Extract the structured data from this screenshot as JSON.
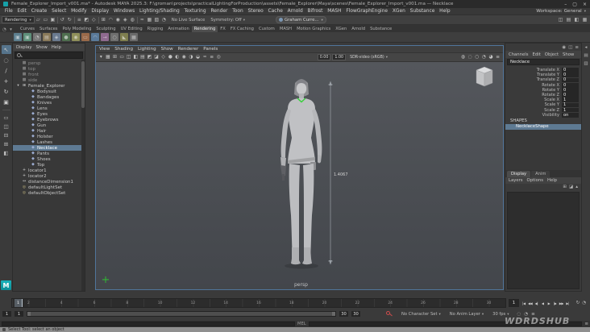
{
  "window": {
    "title": "Female_Explorer_Import_v001.ma* - Autodesk MAYA 2025.3: F:\\groman\\projects\\practicalLightingForProduction\\assets\\Female_Explorer\\Maya\\scenes\\Female_Explorer_Import_v001.ma — Necklace",
    "controls": {
      "minimize": "–",
      "maximize": "▢",
      "close": "×"
    }
  },
  "menu_bar": {
    "items": [
      "File",
      "Edit",
      "Create",
      "Select",
      "Modify",
      "Display",
      "Windows",
      "Lighting/Shading",
      "Texturing",
      "Render",
      "Toon",
      "Stereo",
      "Cache",
      "Arnold",
      "Bifrost",
      "MASH",
      "FlowGraphEngine",
      "XGen",
      "Substance",
      "Help"
    ],
    "workspace_label": "Workspace:",
    "workspace_value": "General"
  },
  "status_line": {
    "menuset_label": "Rendering",
    "icons": [
      {
        "name": "new-scene-icon",
        "g": "▱"
      },
      {
        "name": "open-scene-icon",
        "g": "▭"
      },
      {
        "name": "save-scene-icon",
        "g": "▣"
      },
      {
        "name": "separator",
        "g": "",
        "cls": "sep"
      },
      {
        "name": "undo-icon",
        "g": "↺"
      },
      {
        "name": "redo-icon",
        "g": "↻"
      },
      {
        "name": "separator",
        "g": "",
        "cls": "sep"
      },
      {
        "name": "select-hierarchy-icon",
        "g": "≡"
      },
      {
        "name": "select-object-icon",
        "g": "◩"
      },
      {
        "name": "select-component-icon",
        "g": "◇"
      },
      {
        "name": "separator",
        "g": "",
        "cls": "sep"
      },
      {
        "name": "snap-grid-icon",
        "g": "⊞"
      },
      {
        "name": "snap-curve-icon",
        "g": "◠"
      },
      {
        "name": "snap-point-icon",
        "g": "◉"
      },
      {
        "name": "snap-plane-icon",
        "g": "◈"
      },
      {
        "name": "make-live-icon",
        "g": "◍"
      },
      {
        "name": "separator",
        "g": "",
        "cls": "sep"
      },
      {
        "name": "construction-history-icon",
        "g": "≈"
      },
      {
        "name": "render-frame-icon",
        "g": "▦"
      },
      {
        "name": "ipr-render-icon",
        "g": "▧"
      },
      {
        "name": "render-settings-icon",
        "g": "◔"
      }
    ],
    "no_live_surface": "No Live Surface",
    "symmetry_label": "Symmetry: Off",
    "account_label": "Graham Curre...",
    "right_icons": [
      {
        "name": "modeling-toolkit-toggle-icon",
        "g": "◫"
      },
      {
        "name": "attribute-editor-toggle-icon",
        "g": "▤"
      },
      {
        "name": "tool-settings-toggle-icon",
        "g": "◧"
      },
      {
        "name": "channel-box-toggle-icon",
        "g": "▦"
      }
    ]
  },
  "shelf": {
    "tabs": [
      {
        "label": "Curves",
        "cls": ""
      },
      {
        "label": "Surfaces",
        "cls": ""
      },
      {
        "label": "Poly Modeling",
        "cls": ""
      },
      {
        "label": "Sculpting",
        "cls": ""
      },
      {
        "label": "UV Editing",
        "cls": ""
      },
      {
        "label": "Rigging",
        "cls": ""
      },
      {
        "label": "Animation",
        "cls": ""
      },
      {
        "label": "Rendering",
        "cls": "active"
      },
      {
        "label": "FX",
        "cls": ""
      },
      {
        "label": "FX Caching",
        "cls": ""
      },
      {
        "label": "Custom",
        "cls": ""
      },
      {
        "label": "MASH",
        "cls": ""
      },
      {
        "label": "Motion Graphics",
        "cls": ""
      },
      {
        "label": "XGen",
        "cls": ""
      },
      {
        "label": "Arnold",
        "cls": ""
      },
      {
        "label": "Substance",
        "cls": ""
      }
    ],
    "icons": [
      {
        "name": "render-current-frame-icon",
        "c": "#5d7f8f",
        "g": "▣"
      },
      {
        "name": "ipr-render-shelf-icon",
        "c": "#5d8f7a",
        "g": "▣"
      },
      {
        "name": "render-settings-shelf-icon",
        "c": "#757575",
        "g": "◔"
      },
      {
        "name": "render-view-icon",
        "c": "#8a7a5a",
        "g": "▤"
      },
      {
        "name": "hypershade-icon",
        "c": "#6a7a8f",
        "g": "◈"
      },
      {
        "name": "standard-surface-icon",
        "c": "#4f6f4f",
        "g": "●"
      },
      {
        "name": "arnold-light-icon",
        "c": "#8f8f5a",
        "g": "◉"
      },
      {
        "name": "area-light-icon",
        "c": "#9a6a4a",
        "g": "▭"
      },
      {
        "name": "skydome-light-icon",
        "c": "#5a7a9a",
        "g": "◠"
      },
      {
        "name": "directional-light-icon",
        "c": "#8f6a8f",
        "g": "→"
      },
      {
        "name": "point-light-icon",
        "c": "#6f6f6f",
        "g": "○"
      },
      {
        "name": "spot-light-icon",
        "c": "#7f7f4f",
        "g": "◣"
      },
      {
        "name": "camera-shelf-icon",
        "c": "#6a6a6a",
        "g": "▦"
      }
    ]
  },
  "toolbox": {
    "tools": [
      {
        "name": "select-tool",
        "g": "↖",
        "cls": "active"
      },
      {
        "name": "lasso-select-tool",
        "g": "◌",
        "cls": ""
      },
      {
        "name": "paint-select-tool",
        "g": "∕",
        "cls": ""
      },
      {
        "name": "move-tool",
        "g": "+",
        "cls": ""
      },
      {
        "name": "rotate-tool",
        "g": "↻",
        "cls": ""
      },
      {
        "name": "scale-tool",
        "g": "▣",
        "cls": ""
      }
    ],
    "layouts": [
      {
        "name": "single-pane-layout",
        "g": "▭"
      },
      {
        "name": "two-pane-side-layout",
        "g": "◫"
      },
      {
        "name": "two-pane-stacked-layout",
        "g": "⊟"
      },
      {
        "name": "four-pane-layout",
        "g": "⊞"
      },
      {
        "name": "outliner-persp-layout",
        "g": "◧"
      }
    ],
    "logo_label": "M"
  },
  "outliner": {
    "menus": [
      "Display",
      "Show",
      "Help"
    ],
    "items": [
      {
        "label": "persp",
        "cls": "cam",
        "icon": "▦",
        "exp": ""
      },
      {
        "label": "top",
        "cls": "cam",
        "icon": "▦",
        "exp": ""
      },
      {
        "label": "front",
        "cls": "cam",
        "icon": "▦",
        "exp": ""
      },
      {
        "label": "side",
        "cls": "cam",
        "icon": "▦",
        "exp": ""
      },
      {
        "label": "Female_Explorer",
        "cls": "xform",
        "icon": "⊞",
        "exp": "▾"
      },
      {
        "label": "Bodysuit",
        "cls": "d1 mesh",
        "icon": "◆",
        "exp": ""
      },
      {
        "label": "Bandages",
        "cls": "d1 mesh",
        "icon": "◆",
        "exp": ""
      },
      {
        "label": "Knives",
        "cls": "d1 mesh",
        "icon": "◆",
        "exp": ""
      },
      {
        "label": "Lens",
        "cls": "d1 mesh",
        "icon": "◆",
        "exp": ""
      },
      {
        "label": "Eyes",
        "cls": "d1 mesh",
        "icon": "◆",
        "exp": ""
      },
      {
        "label": "Eyebrows",
        "cls": "d1 mesh",
        "icon": "◆",
        "exp": ""
      },
      {
        "label": "Gun",
        "cls": "d1 mesh",
        "icon": "◆",
        "exp": ""
      },
      {
        "label": "Hair",
        "cls": "d1 mesh",
        "icon": "◆",
        "exp": ""
      },
      {
        "label": "Holster",
        "cls": "d1 mesh",
        "icon": "◆",
        "exp": ""
      },
      {
        "label": "Lashes",
        "cls": "d1 mesh",
        "icon": "◆",
        "exp": ""
      },
      {
        "label": "Necklace",
        "cls": "d1 mesh selected",
        "icon": "◆",
        "exp": ""
      },
      {
        "label": "Pants",
        "cls": "d1 mesh",
        "icon": "◆",
        "exp": ""
      },
      {
        "label": "Shoes",
        "cls": "d1 mesh",
        "icon": "◆",
        "exp": ""
      },
      {
        "label": "Top",
        "cls": "d1 mesh",
        "icon": "◆",
        "exp": ""
      },
      {
        "label": "locator1",
        "cls": "loc",
        "icon": "+",
        "exp": ""
      },
      {
        "label": "locator2",
        "cls": "loc",
        "icon": "+",
        "exp": ""
      },
      {
        "label": "distanceDimension1",
        "cls": "dim",
        "icon": "↔",
        "exp": ""
      },
      {
        "label": "defaultLightSet",
        "cls": "set",
        "icon": "◎",
        "exp": ""
      },
      {
        "label": "defaultObjectSet",
        "cls": "set",
        "icon": "◎",
        "exp": ""
      }
    ]
  },
  "viewport": {
    "menus": [
      "View",
      "Shading",
      "Lighting",
      "Show",
      "Renderer",
      "Panels"
    ],
    "toolbar_left": [
      {
        "name": "camera-menu-icon",
        "g": "▾"
      },
      {
        "name": "camera-select-icon",
        "g": "▦"
      },
      {
        "name": "grid-toggle-icon",
        "g": "⊞"
      },
      {
        "name": "film-gate-icon",
        "g": "▭"
      },
      {
        "name": "resolution-gate-icon",
        "g": "◫"
      },
      {
        "name": "gate-mask-icon",
        "g": "◧"
      },
      {
        "name": "field-chart-icon",
        "g": "▤"
      },
      {
        "name": "safe-action-icon",
        "g": "◩"
      },
      {
        "name": "safe-title-icon",
        "g": "◪"
      },
      {
        "name": "wireframe-icon",
        "g": "◇"
      },
      {
        "name": "shaded-icon",
        "g": "●"
      },
      {
        "name": "textured-icon",
        "g": "◐"
      },
      {
        "name": "use-all-lights-icon",
        "g": "◉"
      },
      {
        "name": "shadows-icon",
        "g": "◑"
      },
      {
        "name": "ambient-occlusion-icon",
        "g": "◒"
      },
      {
        "name": "motion-blur-icon",
        "g": "≈"
      },
      {
        "name": "anti-aliasing-icon",
        "g": "≡"
      },
      {
        "name": "depth-of-field-icon",
        "g": "◎"
      }
    ],
    "exposure": "0.00",
    "gamma": "1.00",
    "view_transform": "SDR-video (sRGB)",
    "toolbar_right": [
      {
        "name": "isolate-select-icon",
        "g": "◍"
      },
      {
        "name": "xray-icon",
        "g": "◌"
      },
      {
        "name": "joints-xray-icon",
        "g": "○"
      },
      {
        "name": "exposure-icon",
        "g": "◔"
      },
      {
        "name": "gamma-icon",
        "g": "◕"
      },
      {
        "name": "viewport-options-icon",
        "g": "≡"
      }
    ],
    "camera_label": "persp",
    "measurement": "1.4067"
  },
  "channel_box": {
    "top_icons": [
      {
        "name": "pin-panel-icon",
        "g": "◉"
      },
      {
        "name": "panel-layout-icon",
        "g": "◫"
      },
      {
        "name": "panel-menu-icon",
        "g": "≡"
      }
    ],
    "menus": [
      "Channels",
      "Edit",
      "Object",
      "Show"
    ],
    "object_name": "Necklace",
    "attributes": [
      {
        "name": "Translate X",
        "value": "0"
      },
      {
        "name": "Translate Y",
        "value": "0"
      },
      {
        "name": "Translate Z",
        "value": "0"
      },
      {
        "name": "Rotate X",
        "value": "0"
      },
      {
        "name": "Rotate Y",
        "value": "0"
      },
      {
        "name": "Rotate Z",
        "value": "0"
      },
      {
        "name": "Scale X",
        "value": "1"
      },
      {
        "name": "Scale Y",
        "value": "1"
      },
      {
        "name": "Scale Z",
        "value": "1"
      },
      {
        "name": "Visibility",
        "value": "on"
      }
    ],
    "shapes_label": "SHAPES",
    "shape_name": "NecklaceShape"
  },
  "layer_editor": {
    "tabs": [
      {
        "label": "Display",
        "cls": "active"
      },
      {
        "label": "Anim",
        "cls": ""
      }
    ],
    "menus": [
      "Layers",
      "Options",
      "Help"
    ],
    "icons": [
      {
        "name": "new-empty-layer-icon",
        "g": "⊞"
      },
      {
        "name": "new-layer-from-selected-icon",
        "g": "◪"
      },
      {
        "name": "move-layer-up-icon",
        "g": "▴"
      }
    ]
  },
  "right_strip": {
    "icons": [
      {
        "name": "collapse-sidebar-icon",
        "g": "◂"
      },
      {
        "name": "channel-box-tab-icon",
        "g": "▤"
      },
      {
        "name": "layer-editor-tab-icon",
        "g": "▥"
      }
    ]
  },
  "timeline": {
    "labels": [
      "2",
      "4",
      "6",
      "8",
      "10",
      "12",
      "14",
      "16",
      "18",
      "20",
      "22",
      "24",
      "26",
      "28",
      "30"
    ],
    "current_frame": "1",
    "current_time_field": "1",
    "transport": [
      {
        "name": "go-to-start-button",
        "g": "|◀"
      },
      {
        "name": "step-back-key-button",
        "g": "◀◀"
      },
      {
        "name": "step-back-frame-button",
        "g": "◀|"
      },
      {
        "name": "play-backward-button",
        "g": "◀"
      },
      {
        "name": "play-forward-button",
        "g": "▶"
      },
      {
        "name": "step-forward-frame-button",
        "g": "|▶"
      },
      {
        "name": "step-forward-key-button",
        "g": "▶▶"
      },
      {
        "name": "go-to-end-button",
        "g": "▶|"
      }
    ],
    "extra_icons": [
      {
        "name": "playback-loop-icon",
        "g": "↻"
      },
      {
        "name": "animation-preferences-icon",
        "g": "◔"
      }
    ]
  },
  "range_slider": {
    "anim_start": "1",
    "play_start": "1",
    "play_end": "30",
    "anim_end": "30",
    "character_set": "No Character Set",
    "anim_layer": "No Anim Layer",
    "fps_label": "30 fps",
    "icons": [
      {
        "name": "mute-playback-icon",
        "g": "◌"
      },
      {
        "name": "playback-options-icon",
        "g": "◔"
      },
      {
        "name": "range-slider-menu-icon",
        "g": "≡"
      }
    ]
  },
  "command_line": {
    "label": "MEL"
  },
  "help_line": {
    "text": "Select Tool: select an object"
  },
  "watermark": "WDRDSHUB"
}
